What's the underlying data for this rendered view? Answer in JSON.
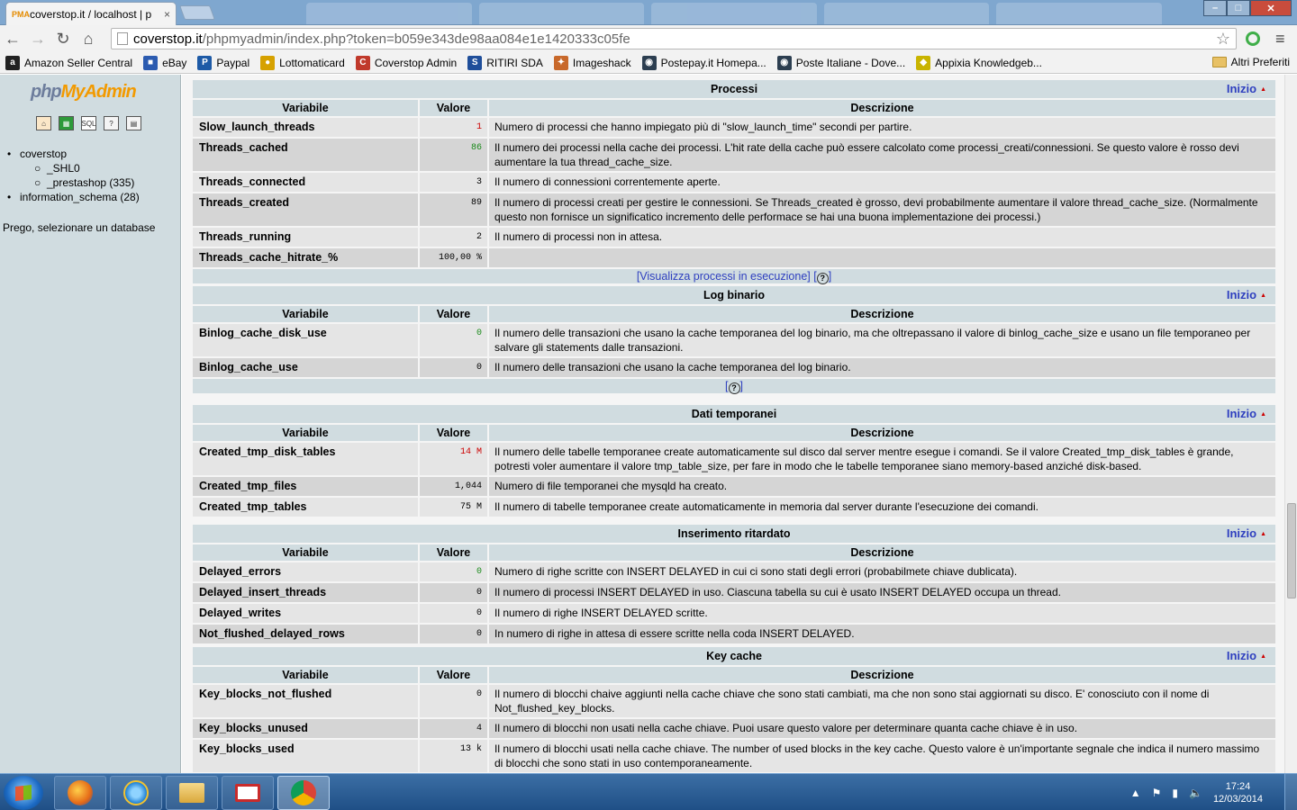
{
  "browser": {
    "tab_title": "coverstop.it / localhost | p",
    "tab_close": "×",
    "url_domain": "coverstop.it",
    "url_rest": "/phpmyadmin/index.php?token=b059e343de98aa084e1e1420333c05fe",
    "bookmarks": [
      {
        "label": "Amazon Seller Central",
        "icon": "a",
        "color": "#222222"
      },
      {
        "label": "eBay",
        "icon": "■",
        "color": "#2b5bb0"
      },
      {
        "label": "Paypal",
        "icon": "P",
        "color": "#1d5aa6"
      },
      {
        "label": "Lottomaticard",
        "icon": "●",
        "color": "#d6a100"
      },
      {
        "label": "Coverstop Admin",
        "icon": "C",
        "color": "#c0392b"
      },
      {
        "label": "RITIRI SDA",
        "icon": "S",
        "color": "#1f4e9a"
      },
      {
        "label": "Imageshack",
        "icon": "✦",
        "color": "#c8682a"
      },
      {
        "label": "Postepay.it Homepa...",
        "icon": "◉",
        "color": "#2c3e50"
      },
      {
        "label": "Poste Italiane - Dove...",
        "icon": "◉",
        "color": "#2c3e50"
      },
      {
        "label": "Appixia Knowledgeb...",
        "icon": "◆",
        "color": "#c9b400"
      }
    ],
    "bookmarks_other": "Altri Preferiti"
  },
  "left": {
    "logo_php": "php",
    "logo_myadmin": "MyAdmin",
    "icons": [
      "home-icon",
      "table-icon",
      "sql-icon",
      "query-window-icon",
      "docs-icon"
    ],
    "tree": {
      "db1": "coverstop",
      "db1_sub1": "_SHL0",
      "db1_sub2": "_prestashop (335)",
      "db2": "information_schema (28)"
    },
    "note": "Prego, selezionare un database"
  },
  "headers": {
    "variable": "Variabile",
    "value": "Valore",
    "description": "Descrizione"
  },
  "inizio": "Inizio",
  "sections": {
    "processi": {
      "title": "Processi",
      "footer_link": "[Visualizza processi in esecuzione]",
      "rows": [
        {
          "name": "Slow_launch_threads",
          "value": "1",
          "desc": "Numero di processi che hanno impiegato più di \"slow_launch_time\" secondi per partire."
        },
        {
          "name": "Threads_cached",
          "value": "86",
          "desc": "Il numero dei processi nella cache dei processi. L'hit rate della cache può essere calcolato come processi_creati/connessioni. Se questo valore è rosso devi aumentare la tua thread_cache_size."
        },
        {
          "name": "Threads_connected",
          "value": "3",
          "desc": "Il numero di connessioni correntemente aperte."
        },
        {
          "name": "Threads_created",
          "value": "89",
          "desc": "Il numero di processi creati per gestire le connessioni. Se Threads_created è grosso, devi probabilmente aumentare il valore thread_cache_size. (Normalmente questo non fornisce un significatico incremento delle performace se hai una buona implementazione dei processi.)"
        },
        {
          "name": "Threads_running",
          "value": "2",
          "desc": "Il numero di processi non in attesa."
        },
        {
          "name": "Threads_cache_hitrate_%",
          "value": "100,00 %",
          "desc": ""
        }
      ]
    },
    "log": {
      "title": "Log binario",
      "rows": [
        {
          "name": "Binlog_cache_disk_use",
          "value": "0",
          "desc": "Il numero delle transazioni che usano la cache temporanea del log binario, ma che oltrepassano il valore di binlog_cache_size e usano un file temporaneo per salvare gli statements dalle transazioni."
        },
        {
          "name": "Binlog_cache_use",
          "value": "0",
          "desc": "Il numero delle transazioni che usano la cache temporanea del log binario."
        }
      ]
    },
    "tmp": {
      "title": "Dati temporanei",
      "rows": [
        {
          "name": "Created_tmp_disk_tables",
          "value": "14 M",
          "desc": "Il numero delle tabelle temporanee create automaticamente sul disco dal server mentre esegue i comandi. Se il valore Created_tmp_disk_tables è grande, potresti voler aumentare il valore tmp_table_size, per fare in modo che le tabelle temporanee siano memory-based anziché disk-based."
        },
        {
          "name": "Created_tmp_files",
          "value": "1,044",
          "desc": "Numero di file temporanei che mysqld ha creato."
        },
        {
          "name": "Created_tmp_tables",
          "value": "75 M",
          "desc": "Il numero di tabelle temporanee create automaticamente in memoria dal server durante l'esecuzione dei comandi."
        }
      ]
    },
    "delayed": {
      "title": "Inserimento ritardato",
      "rows": [
        {
          "name": "Delayed_errors",
          "value": "0",
          "desc": "Numero di righe scritte con INSERT DELAYED in cui ci sono stati degli errori (probabilmete chiave dublicata)."
        },
        {
          "name": "Delayed_insert_threads",
          "value": "0",
          "desc": "Il numero di processi INSERT DELAYED in uso. Ciascuna tabella su cui è usato INSERT DELAYED occupa un thread."
        },
        {
          "name": "Delayed_writes",
          "value": "0",
          "desc": "Il numero di righe INSERT DELAYED scritte."
        },
        {
          "name": "Not_flushed_delayed_rows",
          "value": "0",
          "desc": "In numero di righe in attesa di essere scritte nella coda INSERT DELAYED."
        }
      ]
    },
    "key": {
      "title": "Key cache",
      "rows": [
        {
          "name": "Key_blocks_not_flushed",
          "value": "0",
          "desc": "Il numero di blocchi chaive aggiunti nella cache chiave che sono stati cambiati, ma che non sono stai aggiornati su disco. E' conosciuto con il nome di Not_flushed_key_blocks."
        },
        {
          "name": "Key_blocks_unused",
          "value": "4",
          "desc": "Il numero di blocchi non usati nella cache chiave. Puoi usare questo valore per determinare quanta cache chiave è in uso."
        },
        {
          "name": "Key_blocks_used",
          "value": "13 k",
          "desc": "Il numero di blocchi usati nella cache chiave. The number of used blocks in the key cache. Questo valore è un'importante segnale che indica il numero massimo di blocchi che sono stati in uso contemporaneamente."
        }
      ]
    }
  },
  "taskbar": {
    "time": "17:24",
    "date": "12/03/2014"
  }
}
